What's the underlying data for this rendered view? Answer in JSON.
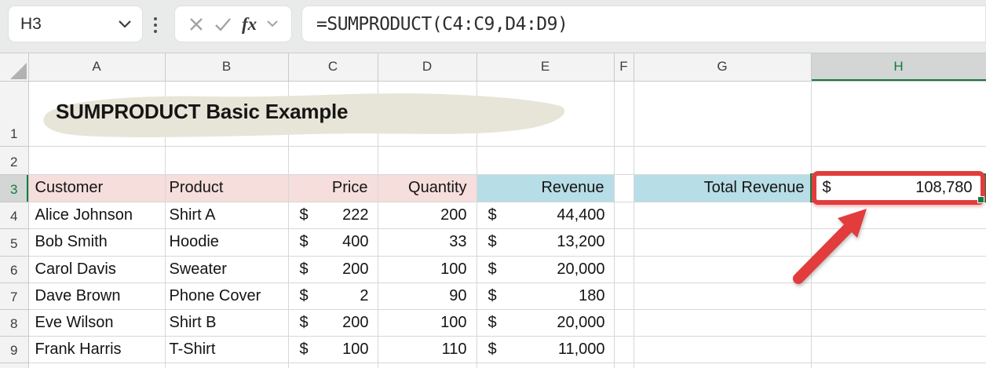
{
  "toolbar": {
    "name_box": "H3",
    "formula": "=SUMPRODUCT(C4:C9,D4:D9)",
    "fx_label": "fx"
  },
  "grid": {
    "columns": [
      "A",
      "B",
      "C",
      "D",
      "E",
      "F",
      "G",
      "H"
    ],
    "rows": [
      "1",
      "2",
      "3",
      "4",
      "5",
      "6",
      "7",
      "8",
      "9"
    ],
    "selected_column": "H",
    "selected_row": "3",
    "selected_cell": "H3"
  },
  "sheet": {
    "title": "SUMPRODUCT Basic Example",
    "currency_symbol": "$",
    "table": {
      "headers": {
        "customer": "Customer",
        "product": "Product",
        "price": "Price",
        "quantity": "Quantity",
        "revenue": "Revenue"
      },
      "rows": [
        {
          "customer": "Alice Johnson",
          "product": "Shirt A",
          "price": "222",
          "quantity": "200",
          "revenue": "44,400"
        },
        {
          "customer": "Bob Smith",
          "product": "Hoodie",
          "price": "400",
          "quantity": "33",
          "revenue": "13,200"
        },
        {
          "customer": "Carol Davis",
          "product": "Sweater",
          "price": "200",
          "quantity": "100",
          "revenue": "20,000"
        },
        {
          "customer": "Dave Brown",
          "product": "Phone Cover",
          "price": "2",
          "quantity": "90",
          "revenue": "180"
        },
        {
          "customer": "Eve Wilson",
          "product": "Shirt B",
          "price": "200",
          "quantity": "100",
          "revenue": "20,000"
        },
        {
          "customer": "Frank Harris",
          "product": "T-Shirt",
          "price": "100",
          "quantity": "110",
          "revenue": "11,000"
        }
      ]
    },
    "total": {
      "label": "Total Revenue",
      "value": "108,780"
    }
  },
  "colors": {
    "accent_green": "#107c41",
    "header_pink": "#f5dedc",
    "header_blue": "#b7dde6",
    "annotation_red": "#e23c3c",
    "title_highlight": "#e7e5d8"
  }
}
